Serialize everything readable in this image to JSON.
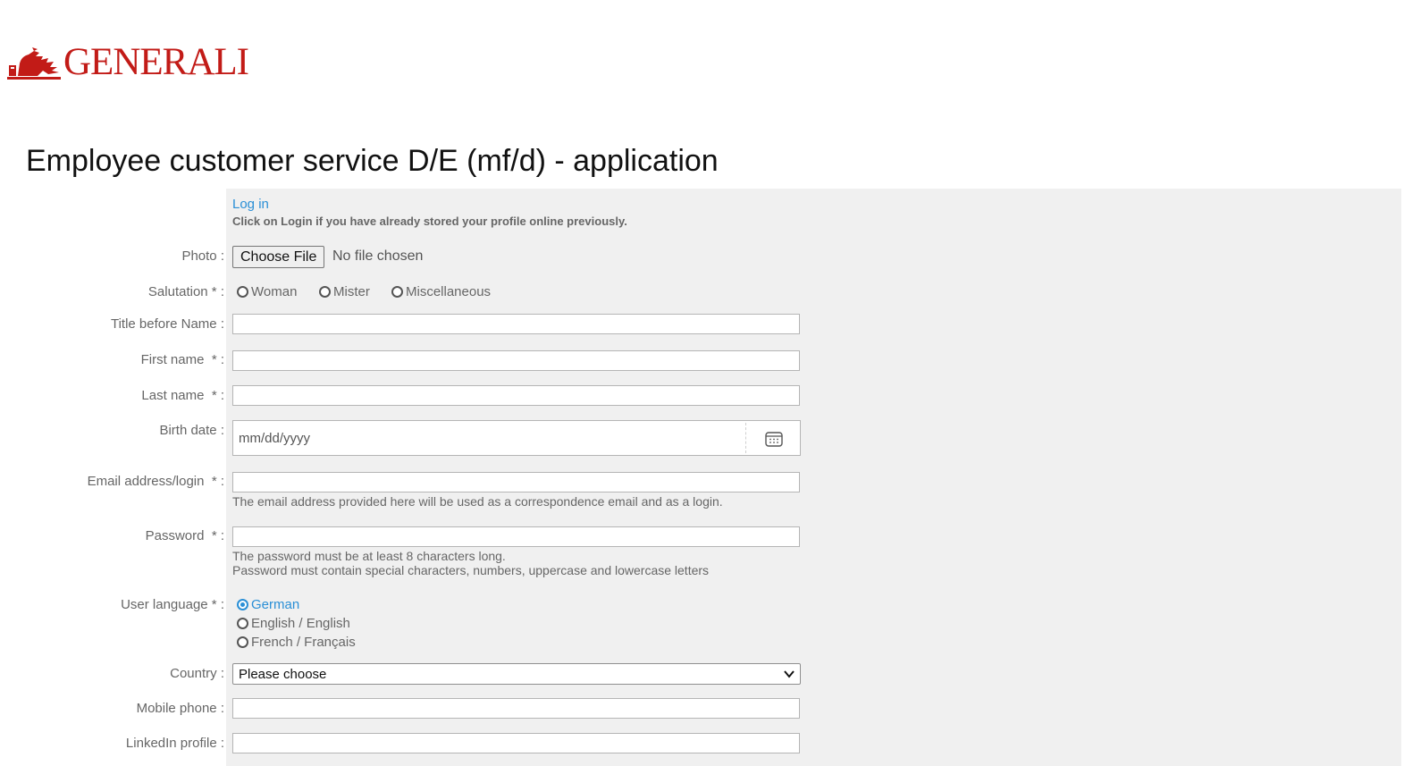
{
  "brand": {
    "name": "GENERALI",
    "color": "#c21b17",
    "logo_icon": "lion-icon"
  },
  "page_title": "Employee customer service D/E (mf/d) - application",
  "login": {
    "link": "Log in",
    "hint": "Click on Login if you have already stored your profile online previously."
  },
  "photo": {
    "label": "Photo",
    "button": "Choose File",
    "status": "No file chosen"
  },
  "salutation": {
    "label": "Salutation *",
    "options": [
      "Woman",
      "Mister",
      "Miscellaneous"
    ]
  },
  "title_before_name": {
    "label": "Title before Name"
  },
  "first_name": {
    "label": "First name",
    "required": "*"
  },
  "last_name": {
    "label": "Last name",
    "required": "*"
  },
  "birth_date": {
    "label": "Birth date",
    "placeholder": "mm/dd/yyyy",
    "icon": "calendar-icon"
  },
  "email": {
    "label": "Email address/login",
    "required": "*",
    "help": "The email address provided here will be used as a correspondence email and as a login."
  },
  "password": {
    "label": "Password",
    "required": "*",
    "help1": "The password must be at least 8 characters long.",
    "help2": "Password must contain special characters, numbers, uppercase and lowercase letters"
  },
  "user_language": {
    "label": "User language *",
    "options": [
      "German",
      "English / English",
      "French / Français"
    ],
    "selected": "German"
  },
  "country": {
    "label": "Country",
    "selected": "Please choose"
  },
  "mobile_phone": {
    "label": "Mobile phone"
  },
  "linkedin": {
    "label": "LinkedIn profile"
  },
  "colors": {
    "link": "#2a8fd6",
    "panel": "#f0f0f0"
  }
}
